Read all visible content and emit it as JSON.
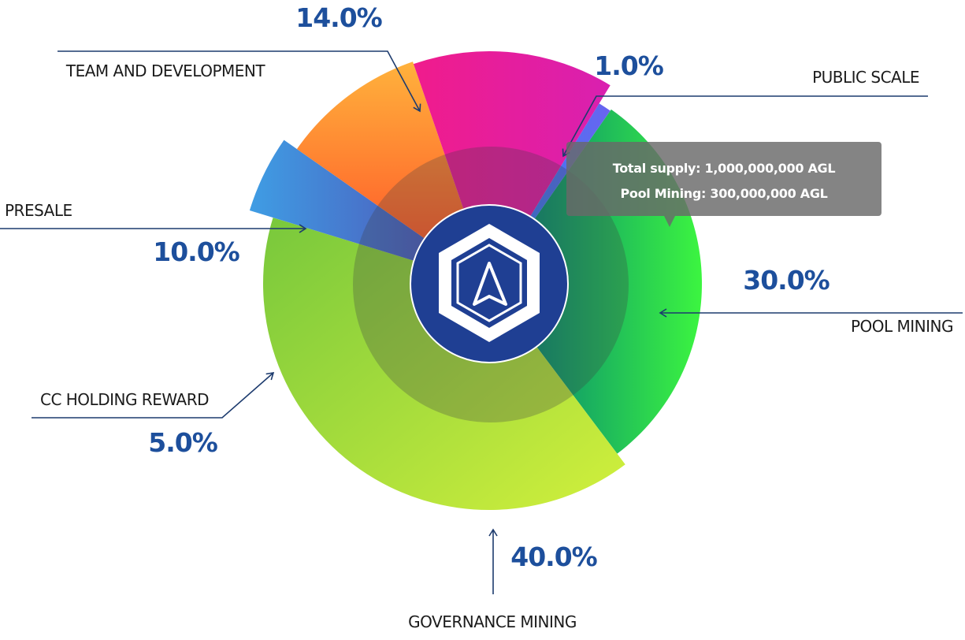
{
  "chart_data": {
    "type": "pie",
    "title": "",
    "slices": [
      {
        "label": "POOL MINING",
        "value": 30.0,
        "display": "30.0%",
        "color": "#2ee84a"
      },
      {
        "label": "GOVERNANCE MINING",
        "value": 40.0,
        "display": "40.0%",
        "color": "#a2dc3e"
      },
      {
        "label": "CC HOLDING REWARD",
        "value": 5.0,
        "display": "5.0%",
        "color": "#4a8fde"
      },
      {
        "label": "PRESALE",
        "value": 10.0,
        "display": "10.0%",
        "color": "#ff8a30"
      },
      {
        "label": "TEAM AND DEVELOPMENT",
        "value": 14.0,
        "display": "14.0%",
        "color": "#e0209a"
      },
      {
        "label": "PUBLIC SCALE",
        "value": 1.0,
        "display": "1.0%",
        "color": "#5a6fee"
      }
    ]
  },
  "tooltip": {
    "line1": "Total supply: 1,000,000,000 AGL",
    "line2": "Pool Mining: 300,000,000 AGL"
  },
  "center_logo": {
    "icon": "hexagon-a-logo-icon",
    "colors": [
      "#1f3f93",
      "#ffffff"
    ]
  }
}
